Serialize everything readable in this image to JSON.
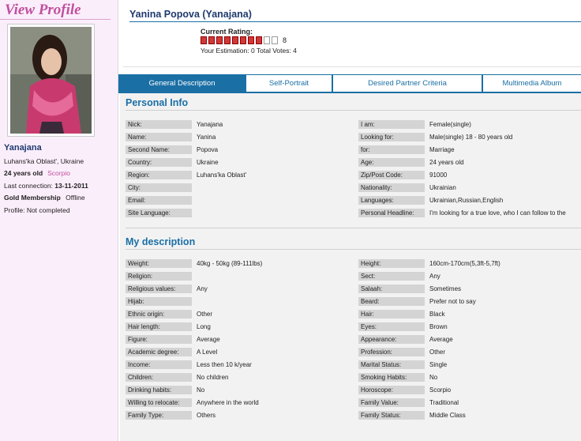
{
  "sidebar": {
    "view_title": "View Profile",
    "nick": "Yanajana",
    "region": "Luhans'ka Oblast', Ukraine",
    "age": "24 years old",
    "zodiac": "Scorpio",
    "last_connection_label": "Last connection:",
    "last_connection_date": "13-11-2011",
    "membership": "Gold Membership",
    "online_status": "Offline",
    "profile_status": "Profile: Not completed"
  },
  "header": {
    "name": "Yanina Popova (Yanajana)",
    "rating_label": "Current Rating:",
    "rating_value": 8,
    "rating_max": 10,
    "rating_text": "8",
    "estimation_votes": "Your Estimation: 0   Total Votes: 4"
  },
  "tabs": [
    {
      "label": "General Description",
      "active": true
    },
    {
      "label": "Self-Portrait",
      "active": false
    },
    {
      "label": "Desired Partner Criteria",
      "active": false
    },
    {
      "label": "Multimedia Album",
      "active": false
    }
  ],
  "personal_info": {
    "title": "Personal Info",
    "left": [
      {
        "label": "Nick:",
        "value": "Yanajana"
      },
      {
        "label": "Name:",
        "value": "Yanina"
      },
      {
        "label": "Second Name:",
        "value": "Popova"
      },
      {
        "label": "Country:",
        "value": "Ukraine"
      },
      {
        "label": "Region:",
        "value": "Luhans'ka Oblast'"
      },
      {
        "label": "City:",
        "value": ""
      },
      {
        "label": "Email:",
        "value": ""
      },
      {
        "label": "Site Language:",
        "value": ""
      }
    ],
    "right": [
      {
        "label": "I am:",
        "value": "Female(single)"
      },
      {
        "label": "Looking for:",
        "value": "Male(single) 18 - 80 years old"
      },
      {
        "label": "for:",
        "value": "Marriage"
      },
      {
        "label": "Age:",
        "value": "24 years old"
      },
      {
        "label": "Zip/Post Code:",
        "value": "91000"
      },
      {
        "label": "Nationality:",
        "value": "Ukrainian"
      },
      {
        "label": "Languages:",
        "value": "Ukrainian,Russian,English"
      },
      {
        "label": "Personal Headline:",
        "value": "I'm looking for a true love, who I can follow to the"
      }
    ]
  },
  "my_description": {
    "title": "My description",
    "left": [
      {
        "label": "Weight:",
        "value": "40kg - 50kg (89-111lbs)"
      },
      {
        "label": "Religion:",
        "value": ""
      },
      {
        "label": "Religious values:",
        "value": "Any"
      },
      {
        "label": "Hijab:",
        "value": ""
      },
      {
        "label": "Ethnic origin:",
        "value": "Other"
      },
      {
        "label": "Hair length:",
        "value": "Long"
      },
      {
        "label": "Figure:",
        "value": "Average"
      },
      {
        "label": "Academic degree:",
        "value": "A Level"
      },
      {
        "label": "Income:",
        "value": "Less then 10 k/year"
      },
      {
        "label": "Children:",
        "value": "No children"
      },
      {
        "label": "Drinking habits:",
        "value": "No"
      },
      {
        "label": "Willing to relocate:",
        "value": "Anywhere in the world"
      },
      {
        "label": "Family Type:",
        "value": "Others"
      }
    ],
    "right": [
      {
        "label": "Height:",
        "value": "160cm-170cm(5,3ft-5,7ft)"
      },
      {
        "label": "Sect:",
        "value": "Any"
      },
      {
        "label": "Salaah:",
        "value": "Sometimes"
      },
      {
        "label": "Beard:",
        "value": "Prefer not to say"
      },
      {
        "label": "Hair:",
        "value": "Black"
      },
      {
        "label": "Eyes:",
        "value": "Brown"
      },
      {
        "label": "Appearance:",
        "value": "Average"
      },
      {
        "label": "Profession:",
        "value": "Other"
      },
      {
        "label": "Marital Status:",
        "value": "Single"
      },
      {
        "label": "Smoking Habits:",
        "value": "No"
      },
      {
        "label": "Horoscope:",
        "value": "Scorpio"
      },
      {
        "label": "Family Value:",
        "value": "Traditional"
      },
      {
        "label": "Family Status:",
        "value": "Middle Class"
      }
    ]
  },
  "colors": {
    "accent": "#1a6fa5",
    "brand_pink": "#c0509e",
    "rating_filled": "#d23838"
  }
}
